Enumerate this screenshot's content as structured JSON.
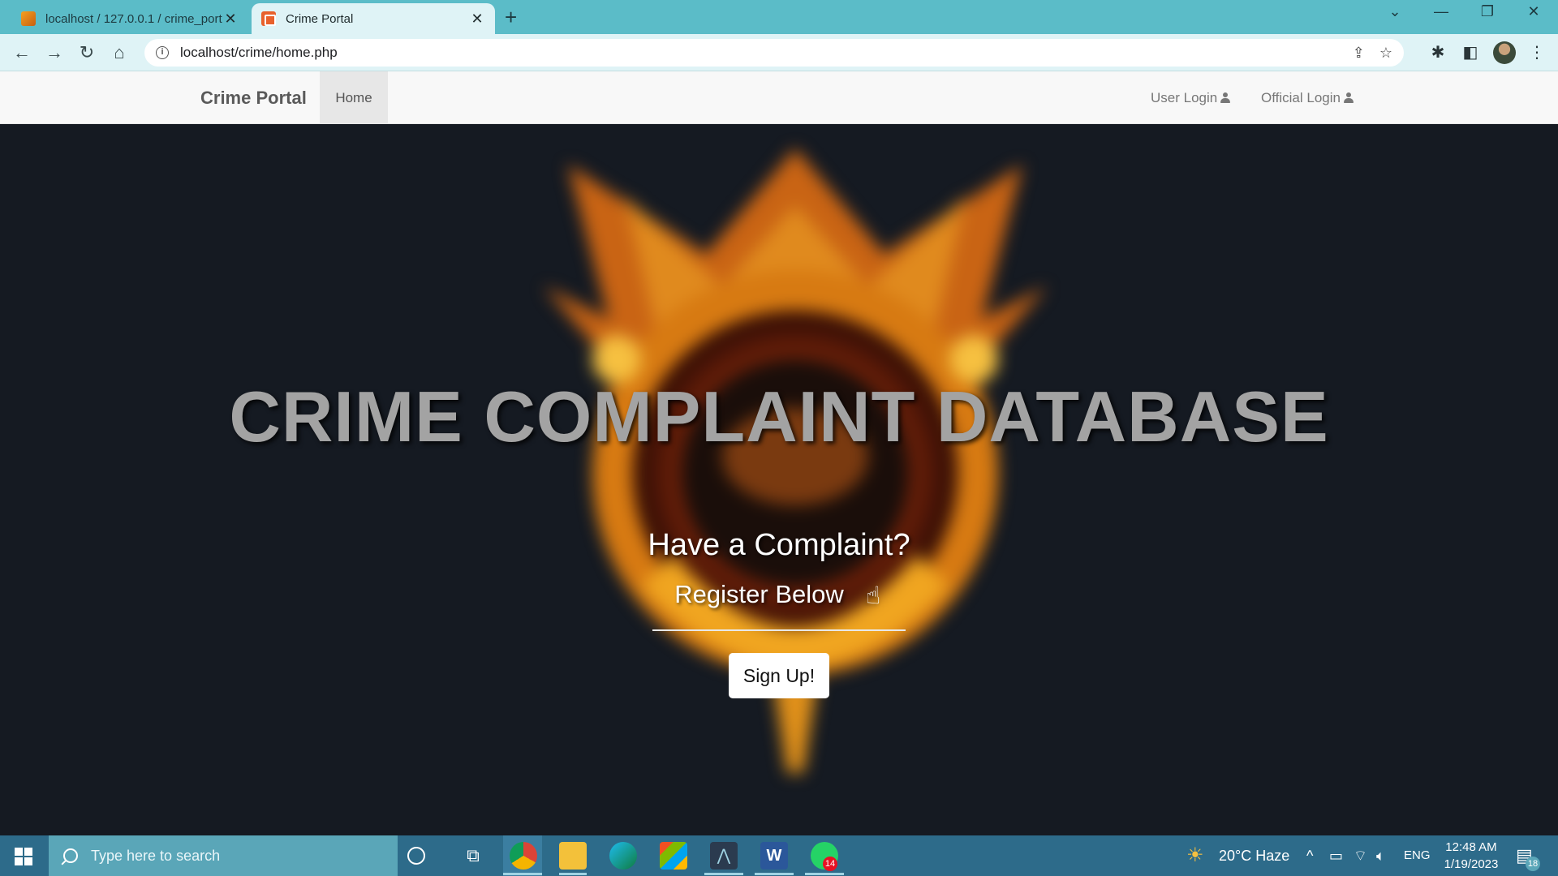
{
  "browser": {
    "tabs": [
      {
        "title": "localhost / 127.0.0.1 / crime_port",
        "active": false
      },
      {
        "title": "Crime Portal",
        "active": true
      }
    ],
    "url": "localhost/crime/home.php"
  },
  "navbar": {
    "brand": "Crime Portal",
    "home": "Home",
    "user_login": "User Login",
    "official_login": "Official Login"
  },
  "hero": {
    "title": "CRIME COMPLAINT DATABASE",
    "question": "Have a Complaint?",
    "register": "Register Below",
    "signup_label": "Sign Up!"
  },
  "taskbar": {
    "search_placeholder": "Type here to search",
    "weather": "20°C  Haze",
    "language": "ENG",
    "time": "12:48 AM",
    "date": "1/19/2023",
    "whatsapp_badge": "14",
    "notifications_badge": "18"
  },
  "colors": {
    "tabbar": "#5bbcc8",
    "toolbar": "#dff3f6",
    "hero_bg": "#151a22",
    "taskbar": "#2d6b8a"
  }
}
